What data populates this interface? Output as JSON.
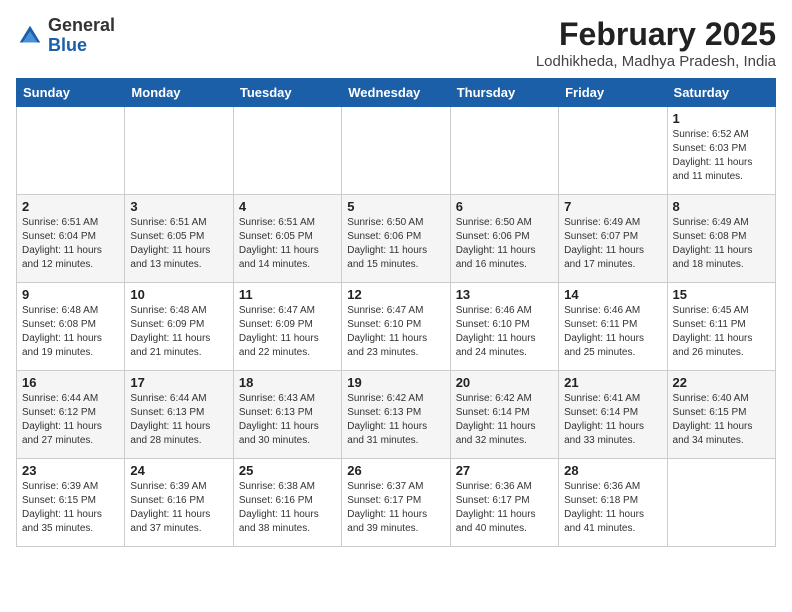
{
  "header": {
    "logo_general": "General",
    "logo_blue": "Blue",
    "month_year": "February 2025",
    "location": "Lodhikheda, Madhya Pradesh, India"
  },
  "days_of_week": [
    "Sunday",
    "Monday",
    "Tuesday",
    "Wednesday",
    "Thursday",
    "Friday",
    "Saturday"
  ],
  "weeks": [
    [
      {
        "day": null,
        "sunrise": null,
        "sunset": null,
        "daylight": null
      },
      {
        "day": null,
        "sunrise": null,
        "sunset": null,
        "daylight": null
      },
      {
        "day": null,
        "sunrise": null,
        "sunset": null,
        "daylight": null
      },
      {
        "day": null,
        "sunrise": null,
        "sunset": null,
        "daylight": null
      },
      {
        "day": null,
        "sunrise": null,
        "sunset": null,
        "daylight": null
      },
      {
        "day": null,
        "sunrise": null,
        "sunset": null,
        "daylight": null
      },
      {
        "day": "1",
        "sunrise": "6:52 AM",
        "sunset": "6:03 PM",
        "daylight": "11 hours and 11 minutes."
      }
    ],
    [
      {
        "day": "2",
        "sunrise": "6:51 AM",
        "sunset": "6:04 PM",
        "daylight": "11 hours and 12 minutes."
      },
      {
        "day": "3",
        "sunrise": "6:51 AM",
        "sunset": "6:05 PM",
        "daylight": "11 hours and 13 minutes."
      },
      {
        "day": "4",
        "sunrise": "6:51 AM",
        "sunset": "6:05 PM",
        "daylight": "11 hours and 14 minutes."
      },
      {
        "day": "5",
        "sunrise": "6:50 AM",
        "sunset": "6:06 PM",
        "daylight": "11 hours and 15 minutes."
      },
      {
        "day": "6",
        "sunrise": "6:50 AM",
        "sunset": "6:06 PM",
        "daylight": "11 hours and 16 minutes."
      },
      {
        "day": "7",
        "sunrise": "6:49 AM",
        "sunset": "6:07 PM",
        "daylight": "11 hours and 17 minutes."
      },
      {
        "day": "8",
        "sunrise": "6:49 AM",
        "sunset": "6:08 PM",
        "daylight": "11 hours and 18 minutes."
      }
    ],
    [
      {
        "day": "9",
        "sunrise": "6:48 AM",
        "sunset": "6:08 PM",
        "daylight": "11 hours and 19 minutes."
      },
      {
        "day": "10",
        "sunrise": "6:48 AM",
        "sunset": "6:09 PM",
        "daylight": "11 hours and 21 minutes."
      },
      {
        "day": "11",
        "sunrise": "6:47 AM",
        "sunset": "6:09 PM",
        "daylight": "11 hours and 22 minutes."
      },
      {
        "day": "12",
        "sunrise": "6:47 AM",
        "sunset": "6:10 PM",
        "daylight": "11 hours and 23 minutes."
      },
      {
        "day": "13",
        "sunrise": "6:46 AM",
        "sunset": "6:10 PM",
        "daylight": "11 hours and 24 minutes."
      },
      {
        "day": "14",
        "sunrise": "6:46 AM",
        "sunset": "6:11 PM",
        "daylight": "11 hours and 25 minutes."
      },
      {
        "day": "15",
        "sunrise": "6:45 AM",
        "sunset": "6:11 PM",
        "daylight": "11 hours and 26 minutes."
      }
    ],
    [
      {
        "day": "16",
        "sunrise": "6:44 AM",
        "sunset": "6:12 PM",
        "daylight": "11 hours and 27 minutes."
      },
      {
        "day": "17",
        "sunrise": "6:44 AM",
        "sunset": "6:13 PM",
        "daylight": "11 hours and 28 minutes."
      },
      {
        "day": "18",
        "sunrise": "6:43 AM",
        "sunset": "6:13 PM",
        "daylight": "11 hours and 30 minutes."
      },
      {
        "day": "19",
        "sunrise": "6:42 AM",
        "sunset": "6:13 PM",
        "daylight": "11 hours and 31 minutes."
      },
      {
        "day": "20",
        "sunrise": "6:42 AM",
        "sunset": "6:14 PM",
        "daylight": "11 hours and 32 minutes."
      },
      {
        "day": "21",
        "sunrise": "6:41 AM",
        "sunset": "6:14 PM",
        "daylight": "11 hours and 33 minutes."
      },
      {
        "day": "22",
        "sunrise": "6:40 AM",
        "sunset": "6:15 PM",
        "daylight": "11 hours and 34 minutes."
      }
    ],
    [
      {
        "day": "23",
        "sunrise": "6:39 AM",
        "sunset": "6:15 PM",
        "daylight": "11 hours and 35 minutes."
      },
      {
        "day": "24",
        "sunrise": "6:39 AM",
        "sunset": "6:16 PM",
        "daylight": "11 hours and 37 minutes."
      },
      {
        "day": "25",
        "sunrise": "6:38 AM",
        "sunset": "6:16 PM",
        "daylight": "11 hours and 38 minutes."
      },
      {
        "day": "26",
        "sunrise": "6:37 AM",
        "sunset": "6:17 PM",
        "daylight": "11 hours and 39 minutes."
      },
      {
        "day": "27",
        "sunrise": "6:36 AM",
        "sunset": "6:17 PM",
        "daylight": "11 hours and 40 minutes."
      },
      {
        "day": "28",
        "sunrise": "6:36 AM",
        "sunset": "6:18 PM",
        "daylight": "11 hours and 41 minutes."
      },
      {
        "day": null,
        "sunrise": null,
        "sunset": null,
        "daylight": null
      }
    ]
  ]
}
